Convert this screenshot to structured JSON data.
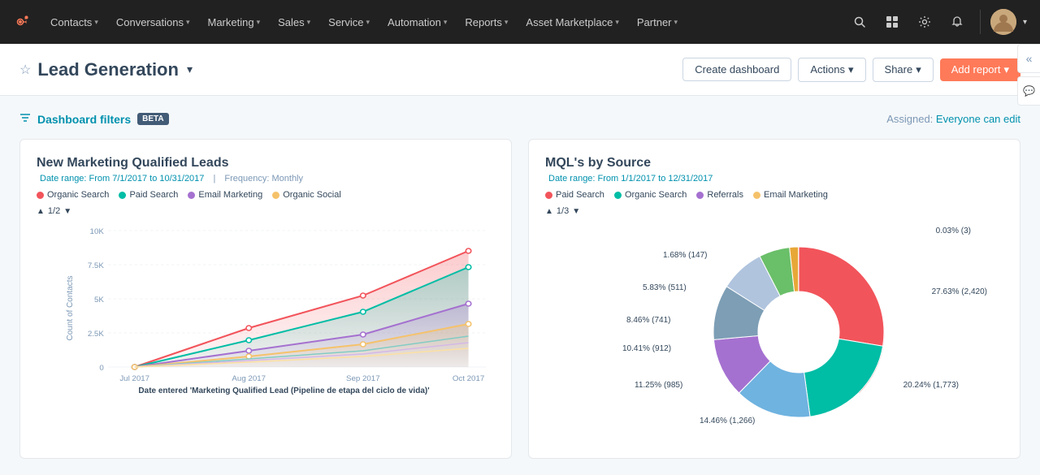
{
  "nav": {
    "logo": "H",
    "items": [
      {
        "label": "Contacts",
        "id": "contacts"
      },
      {
        "label": "Conversations",
        "id": "conversations"
      },
      {
        "label": "Marketing",
        "id": "marketing"
      },
      {
        "label": "Sales",
        "id": "sales"
      },
      {
        "label": "Service",
        "id": "service"
      },
      {
        "label": "Automation",
        "id": "automation"
      },
      {
        "label": "Reports",
        "id": "reports"
      },
      {
        "label": "Asset Marketplace",
        "id": "asset-marketplace"
      },
      {
        "label": "Partner",
        "id": "partner"
      }
    ]
  },
  "header": {
    "title": "Lead Generation",
    "create_dashboard": "Create dashboard",
    "actions": "Actions",
    "share": "Share",
    "add_report": "Add report"
  },
  "filters": {
    "label": "Dashboard filters",
    "beta": "BETA",
    "assigned_label": "Assigned:",
    "assigned_value": "Everyone can edit"
  },
  "chart1": {
    "title": "New Marketing Qualified Leads",
    "date_range": "Date range: From 7/1/2017 to 10/31/2017",
    "frequency": "Frequency: Monthly",
    "page_nav": "1/2",
    "legend": [
      {
        "label": "Organic Search",
        "color": "#f2545b"
      },
      {
        "label": "Paid Search",
        "color": "#00bda5"
      },
      {
        "label": "Email Marketing",
        "color": "#a571d0"
      },
      {
        "label": "Organic Social",
        "color": "#f5c26b"
      }
    ],
    "y_label": "Count of Contacts",
    "x_label": "Date entered 'Marketing Qualified Lead (Pipeline de etapa del ciclo de vida)'",
    "x_ticks": [
      "Jul 2017",
      "Aug 2017",
      "Sep 2017",
      "Oct 2017"
    ],
    "y_ticks": [
      "0",
      "2.5K",
      "5K",
      "7.5K",
      "10K"
    ]
  },
  "chart2": {
    "title": "MQL's by Source",
    "date_range": "Date range: From 1/1/2017 to 12/31/2017",
    "page_nav": "1/3",
    "legend": [
      {
        "label": "Paid Search",
        "color": "#f2545b"
      },
      {
        "label": "Organic Search",
        "color": "#00bda5"
      },
      {
        "label": "Referrals",
        "color": "#a571d0"
      },
      {
        "label": "Email Marketing",
        "color": "#f5c26b"
      }
    ],
    "segments": [
      {
        "label": "27.63% (2,420)",
        "color": "#f2545b",
        "percent": 27.63,
        "angle_start": -30,
        "angle_end": 70
      },
      {
        "label": "20.24% (1,773)",
        "color": "#00bda5",
        "percent": 20.24
      },
      {
        "label": "14.46% (1,266)",
        "color": "#6fb3e0",
        "percent": 14.46
      },
      {
        "label": "11.25% (985)",
        "color": "#a571d0",
        "percent": 11.25
      },
      {
        "label": "10.41% (912)",
        "color": "#7d9eb5",
        "percent": 10.41
      },
      {
        "label": "8.46% (741)",
        "color": "#b0c4de",
        "percent": 8.46
      },
      {
        "label": "5.83% (511)",
        "color": "#6abf69",
        "percent": 5.83
      },
      {
        "label": "1.68% (147)",
        "color": "#e8a838",
        "percent": 1.68
      },
      {
        "label": "0.03% (3)",
        "color": "#c0392b",
        "percent": 0.03
      }
    ]
  },
  "colors": {
    "primary": "#ff7a59",
    "link": "#0091ae",
    "nav_bg": "#212121"
  }
}
